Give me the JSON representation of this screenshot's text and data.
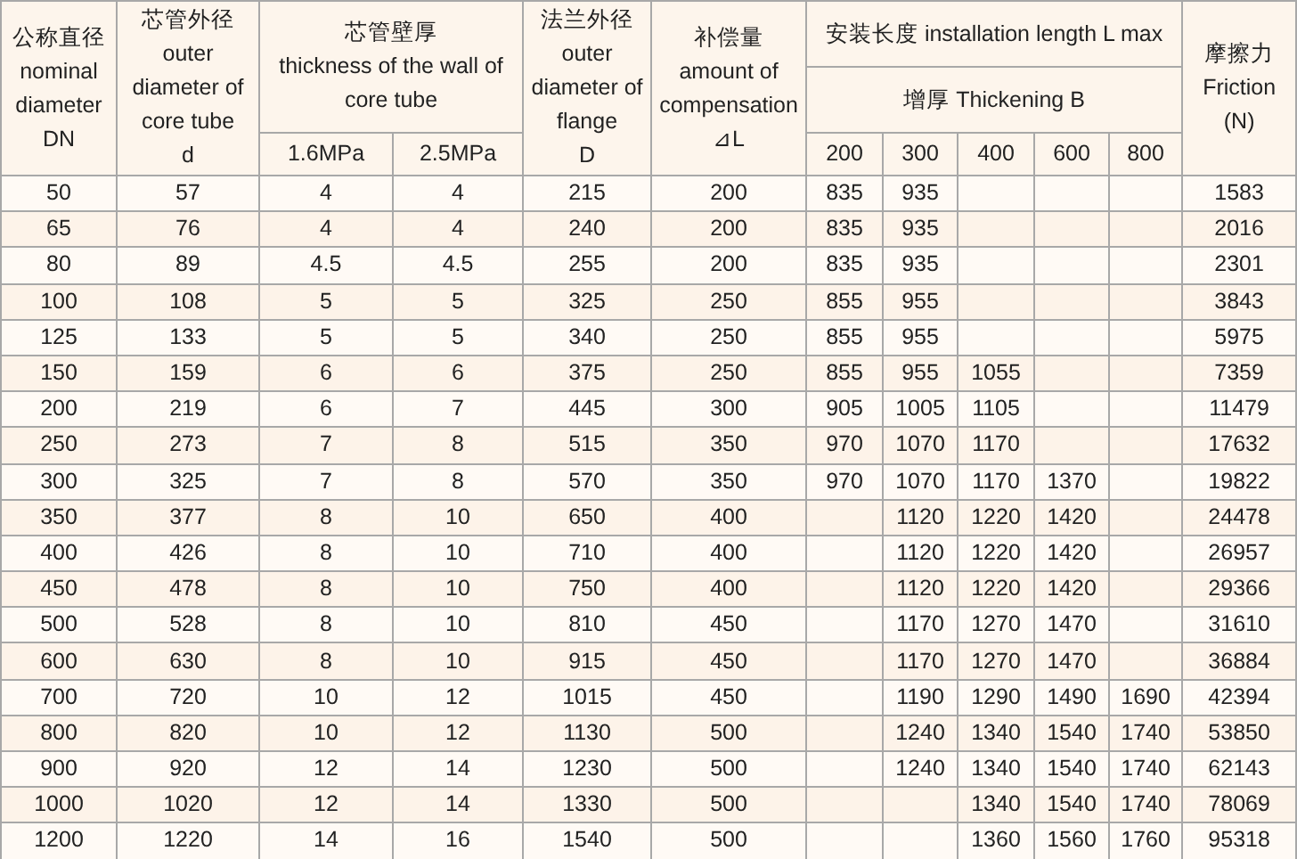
{
  "table": {
    "header": {
      "nominal_diameter": "公称直径\nnominal\ndiameter\nDN",
      "core_tube_outer_diameter": "芯管外径\nouter\ndiameter of\ncore tube\nd",
      "wall_thickness": {
        "title": "芯管壁厚\nthickness of the wall of\ncore tube",
        "pressures": [
          "1.6MPa",
          "2.5MPa"
        ]
      },
      "flange_outer_diameter": "法兰外径\nouter\ndiameter of\nflange\nD",
      "compensation": "补偿量\namount of\ncompensation\n⊿L",
      "installation_length": {
        "title": "安装长度 installation length L max",
        "subtitle": "增厚 Thickening B",
        "thickenings": [
          "200",
          "300",
          "400",
          "600",
          "800"
        ]
      },
      "friction": "摩擦力\nFriction\n(N)"
    },
    "rows": [
      [
        "50",
        "57",
        "4",
        "4",
        "215",
        "200",
        "835",
        "935",
        null,
        null,
        null,
        "1583"
      ],
      [
        "65",
        "76",
        "4",
        "4",
        "240",
        "200",
        "835",
        "935",
        null,
        null,
        null,
        "2016"
      ],
      [
        "80",
        "89",
        "4.5",
        "4.5",
        "255",
        "200",
        "835",
        "935",
        null,
        null,
        null,
        "2301"
      ],
      [
        "100",
        "108",
        "5",
        "5",
        "325",
        "250",
        "855",
        "955",
        null,
        null,
        null,
        "3843"
      ],
      [
        "125",
        "133",
        "5",
        "5",
        "340",
        "250",
        "855",
        "955",
        null,
        null,
        null,
        "5975"
      ],
      [
        "150",
        "159",
        "6",
        "6",
        "375",
        "250",
        "855",
        "955",
        "1055",
        null,
        null,
        "7359"
      ],
      [
        "200",
        "219",
        "6",
        "7",
        "445",
        "300",
        "905",
        "1005",
        "1105",
        null,
        null,
        "11479"
      ],
      [
        "250",
        "273",
        "7",
        "8",
        "515",
        "350",
        "970",
        "1070",
        "1170",
        null,
        null,
        "17632"
      ],
      [
        "300",
        "325",
        "7",
        "8",
        "570",
        "350",
        "970",
        "1070",
        "1170",
        "1370",
        null,
        "19822"
      ],
      [
        "350",
        "377",
        "8",
        "10",
        "650",
        "400",
        null,
        "1120",
        "1220",
        "1420",
        null,
        "24478"
      ],
      [
        "400",
        "426",
        "8",
        "10",
        "710",
        "400",
        null,
        "1120",
        "1220",
        "1420",
        null,
        "26957"
      ],
      [
        "450",
        "478",
        "8",
        "10",
        "750",
        "400",
        null,
        "1120",
        "1220",
        "1420",
        null,
        "29366"
      ],
      [
        "500",
        "528",
        "8",
        "10",
        "810",
        "450",
        null,
        "1170",
        "1270",
        "1470",
        null,
        "31610"
      ],
      [
        "600",
        "630",
        "8",
        "10",
        "915",
        "450",
        null,
        "1170",
        "1270",
        "1470",
        null,
        "36884"
      ],
      [
        "700",
        "720",
        "10",
        "12",
        "1015",
        "450",
        null,
        "1190",
        "1290",
        "1490",
        "1690",
        "42394"
      ],
      [
        "800",
        "820",
        "10",
        "12",
        "1130",
        "500",
        null,
        "1240",
        "1340",
        "1540",
        "1740",
        "53850"
      ],
      [
        "900",
        "920",
        "12",
        "14",
        "1230",
        "500",
        null,
        "1240",
        "1340",
        "1540",
        "1740",
        "62143"
      ],
      [
        "1000",
        "1020",
        "12",
        "14",
        "1330",
        "500",
        null,
        null,
        "1340",
        "1540",
        "1740",
        "78069"
      ],
      [
        "1200",
        "1220",
        "14",
        "16",
        "1540",
        "500",
        null,
        null,
        "1360",
        "1560",
        "1760",
        "95318"
      ]
    ]
  }
}
